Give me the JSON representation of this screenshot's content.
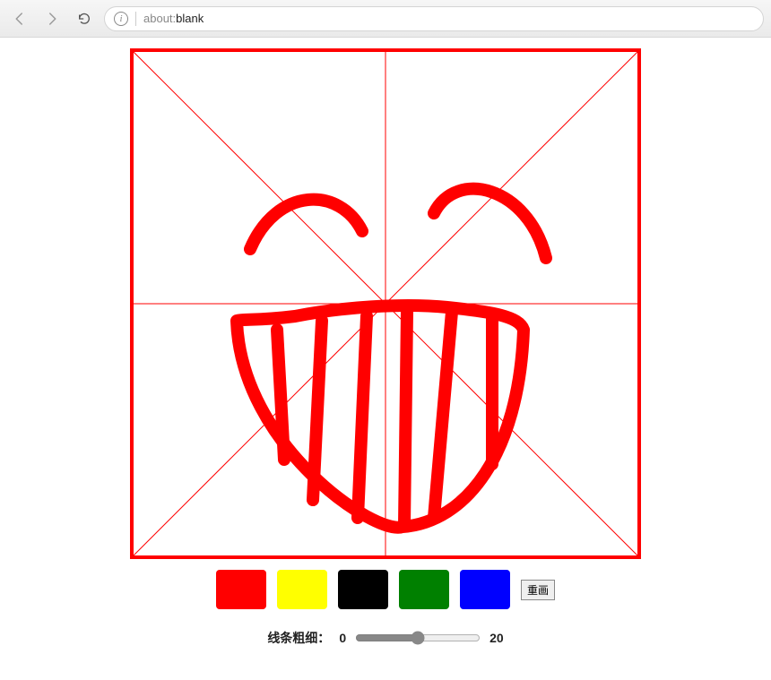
{
  "browser": {
    "url_prefix": "about:",
    "url_page": "blank"
  },
  "canvas": {
    "border_color": "red",
    "grid_color": "red",
    "stroke_color": "red",
    "stroke_width": 14
  },
  "palette": [
    {
      "name": "red",
      "color": "#ff0000"
    },
    {
      "name": "yellow",
      "color": "#ffff00"
    },
    {
      "name": "black",
      "color": "#000000"
    },
    {
      "name": "green",
      "color": "#008000"
    },
    {
      "name": "blue",
      "color": "#0000ff"
    }
  ],
  "buttons": {
    "redraw": "重画"
  },
  "slider": {
    "label": "线条粗细：",
    "min": 0,
    "max": 20,
    "value": 10
  }
}
